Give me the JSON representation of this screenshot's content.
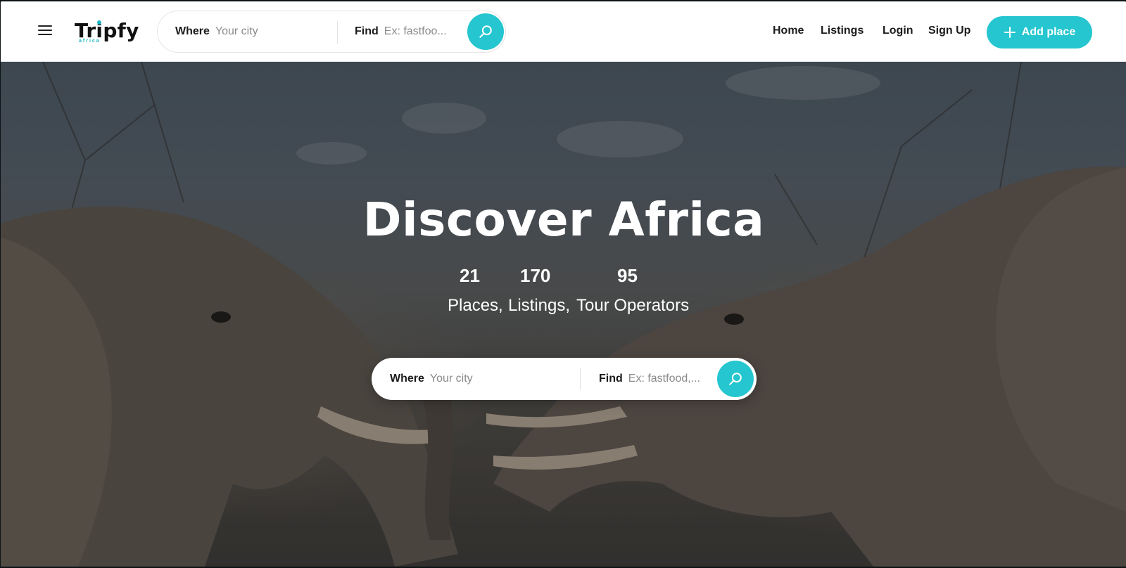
{
  "brand": {
    "name": "Tripfy",
    "tagline": "africa"
  },
  "header": {
    "search": {
      "where_label": "Where",
      "where_placeholder": "Your city",
      "find_label": "Find",
      "find_placeholder": "Ex: fastfoo..."
    },
    "nav": [
      "Home",
      "Listings",
      "Login",
      "Sign Up"
    ],
    "add_place_label": "Add place"
  },
  "hero": {
    "title": "Discover Africa",
    "stats": [
      {
        "value": "21",
        "label": "Places,"
      },
      {
        "value": "170",
        "label": "Listings,"
      },
      {
        "value": "95",
        "label": "Tour Operators"
      }
    ],
    "search": {
      "where_label": "Where",
      "where_placeholder": "Your city",
      "find_label": "Find",
      "find_placeholder": "Ex: fastfood,..."
    }
  },
  "colors": {
    "accent": "#25c6cf",
    "text": "#1c1c1c",
    "hero_text": "#ffffff"
  },
  "icons": {
    "menu": "hamburger-icon",
    "search": "search-icon",
    "add": "plus-icon"
  }
}
